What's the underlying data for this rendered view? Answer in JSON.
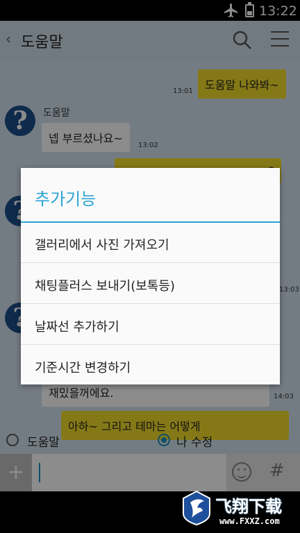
{
  "status_bar": {
    "time": "13:22"
  },
  "header": {
    "title": "도움말"
  },
  "messages": [
    {
      "side": "right",
      "text": "도움말 나와봐~",
      "time": "13:01"
    },
    {
      "side": "left",
      "sender": "도움말",
      "text": "넵 부르셨나요~",
      "time": "13:02"
    },
    {
      "side": "right",
      "text": "?"
    },
    {
      "side": "left",
      "time": "13:03"
    },
    {
      "side": "left",
      "text": "재밌을꺼에요.",
      "time": "14:03"
    },
    {
      "side": "right",
      "text": "아하~ 그리고 테마는 어떻게"
    }
  ],
  "radio": {
    "option_helper": "도움말",
    "option_me": "나 수정",
    "selected": "나 수정"
  },
  "input": {
    "placeholder": ""
  },
  "dialog": {
    "title": "추가기능",
    "items": [
      "갤러리에서 사진 가져오기",
      "채팅플러스 보내기(보톡등)",
      "날짜선 추가하기",
      "기준시간 변경하기"
    ]
  },
  "watermark": {
    "text": "飞翔下载",
    "url": "www.FXXZ.com"
  }
}
